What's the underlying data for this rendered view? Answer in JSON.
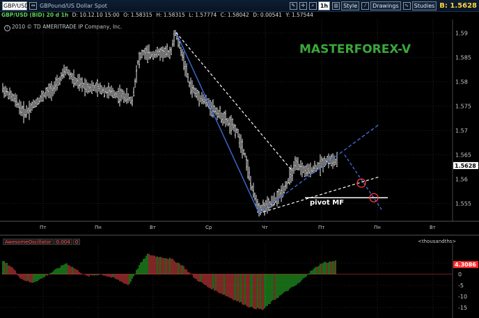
{
  "toolbar": {
    "symbol": "GBP/USD",
    "description": "GBPound/US Dollar Spot",
    "timeframe": "1h",
    "style_label": "Style",
    "drawings_label": "Drawings",
    "studies_label": "Studies",
    "bid": "B: 1.5628"
  },
  "info": {
    "title": "GBP/USD (BID) 20 d 1h",
    "date": "D: 10.12.10 15:00",
    "open": "O: 1.58315",
    "high": "H: 1.58315",
    "low": "L: 1.57774",
    "close": "C: 1.58042",
    "change": "D: 0.00541",
    "y": "Y: 1.57544"
  },
  "copyright": "2010 © TD AMERITRADE IP Company, Inc.",
  "watermark": "MASTERFOREX-V",
  "annotation": "pivot MF",
  "colors": {
    "bull_bar": "#2ed02e",
    "bear_bar": "#ff4a4a",
    "trend_blue": "#3b66c8",
    "watermark": "#3aa83a",
    "circle": "#ff3b3b"
  },
  "price_axis": {
    "ticks": [
      "1.59",
      "1.585",
      "1.58",
      "1.575",
      "1.57",
      "1.565",
      "1.56",
      "1.555"
    ],
    "current": "1.5628"
  },
  "time_axis": {
    "labels": [
      "Пт",
      "Пн",
      "Вт",
      "Ср",
      "Чт",
      "Пт",
      "Пн",
      "Вт"
    ]
  },
  "oscillator": {
    "name": "AwesomeOscillator",
    "value": "0.004",
    "last": "0",
    "units": "<thousandths>",
    "current": "4.3086",
    "ticks": [
      "5",
      "0",
      "-5",
      "-10",
      "-15"
    ]
  }
}
